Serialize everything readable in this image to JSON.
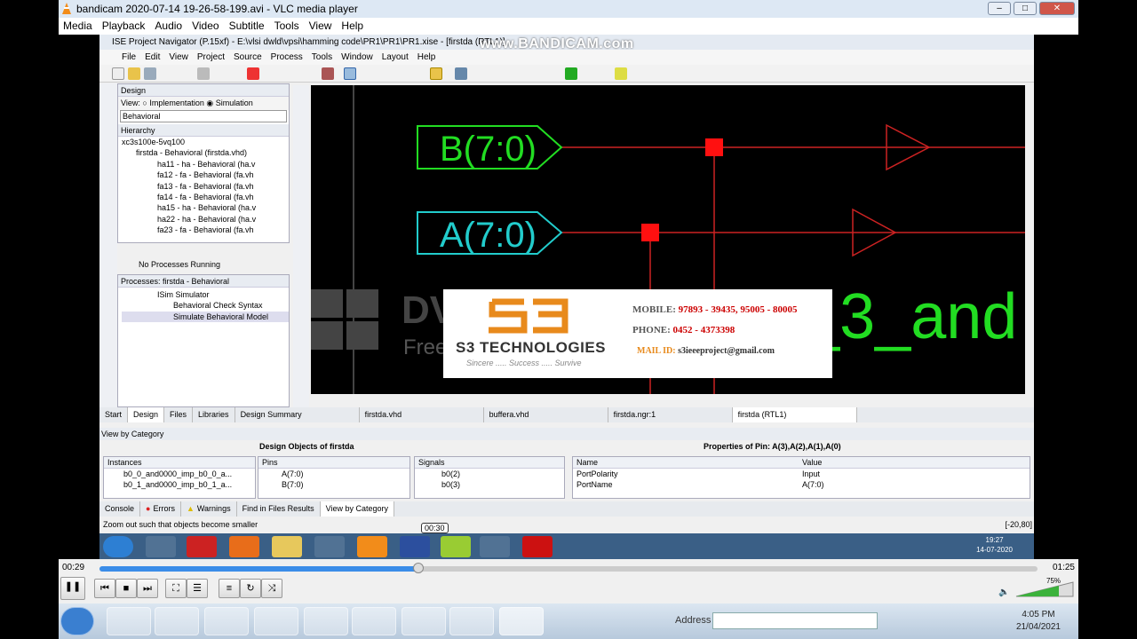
{
  "vlc": {
    "title": "bandicam 2020-07-14 19-26-58-199.avi - VLC media player",
    "menu": [
      "Media",
      "Playback",
      "Audio",
      "Video",
      "Subtitle",
      "Tools",
      "View",
      "Help"
    ],
    "time_elapsed": "00:29",
    "time_total": "01:25",
    "tooltip_time": "00:30",
    "volume": "75%",
    "progress": 0.34
  },
  "ise": {
    "title": "ISE Project Navigator (P.15xf) - E:\\vlsi dwld\\vpsi\\hamming code\\PR1\\PR1\\PR1.xise - [firstda (RTL1)]",
    "watermark": "www.BANDICAM.com",
    "menu": [
      "File",
      "Edit",
      "View",
      "Project",
      "Source",
      "Process",
      "Tools",
      "Window",
      "Layout",
      "Help"
    ],
    "design_label": "Design",
    "view_label": "View:",
    "impl": "Implementation",
    "sim": "Simulation",
    "behavioral": "Behavioral",
    "hierarchy": "Hierarchy",
    "tree": [
      "xc3s100e-5vq100",
      "firstda - Behavioral (firstda.vhd)",
      "ha11 - ha - Behavioral (ha.v",
      "fa12 - fa - Behavioral (fa.vh",
      "fa13 - fa - Behavioral (fa.vh",
      "fa14 - fa - Behavioral (fa.vh",
      "ha15 - ha - Behavioral (ha.v",
      "ha22 - ha - Behavioral (ha.v",
      "fa23 - fa - Behavioral (fa.vh"
    ],
    "no_proc": "No Processes Running",
    "proc_header": "Processes: firstda - Behavioral",
    "procs": [
      "ISim Simulator",
      "Behavioral Check Syntax",
      "Simulate Behavioral Model"
    ],
    "left_tabs": [
      "Start",
      "Design",
      "Files",
      "Libraries"
    ],
    "doc_tabs": [
      "Design Summary",
      "firstda.vhd",
      "buffera.vhd",
      "firstda.ngr:1",
      "firstda (RTL1)"
    ],
    "view_by_category": "View by Category",
    "design_objects": "Design Objects of firstda",
    "pin_props": "Properties of Pin: A(3),A(2),A(1),A(0)",
    "instances_h": "Instances",
    "instances": [
      "b0_0_and0000_imp_b0_0_a...",
      "b0_1_and0000_imp_b0_1_a..."
    ],
    "pins_h": "Pins",
    "pins": [
      "A(7:0)",
      "B(7:0)"
    ],
    "signals_h": "Signals",
    "signals": [
      "b0(2)",
      "b0(3)"
    ],
    "prop_name_h": "Name",
    "prop_value_h": "Value",
    "props": [
      {
        "n": "PortPolarity",
        "v": "Input"
      },
      {
        "n": "PortName",
        "v": "A(7:0)"
      }
    ],
    "status_tabs": [
      "Console",
      "Errors",
      "Warnings",
      "Find in Files Results",
      "View by Category"
    ],
    "status": "Zoom out such that objects become smaller",
    "coords": "[-20,80]",
    "sys_time": "19:27",
    "sys_date": "14-07-2020"
  },
  "schematic": {
    "b_port": "B(7:0)",
    "a_port": "A(7:0)",
    "net_label": "b0_3_and",
    "dv_text": "DV",
    "free_version": "Free version"
  },
  "ad": {
    "brand": "S3 TECHNOLOGIES",
    "tagline": "Sincere ..... Success ..... Survive",
    "mobile_label": "MOBILE:",
    "mobile": "97893 - 39435, 95005 - 80005",
    "phone_label": "PHONE:",
    "phone": "0452 - 4373398",
    "mail_label": "MAIL ID:",
    "mail": "s3ieeeproject@gmail.com"
  },
  "taskbar": {
    "address_label": "Address",
    "time": "4:05 PM",
    "date": "21/04/2021"
  },
  "colors": {
    "green": "#22dd22",
    "cyan": "#22cccc",
    "red": "#ff1010",
    "wire": "#cc2222"
  }
}
